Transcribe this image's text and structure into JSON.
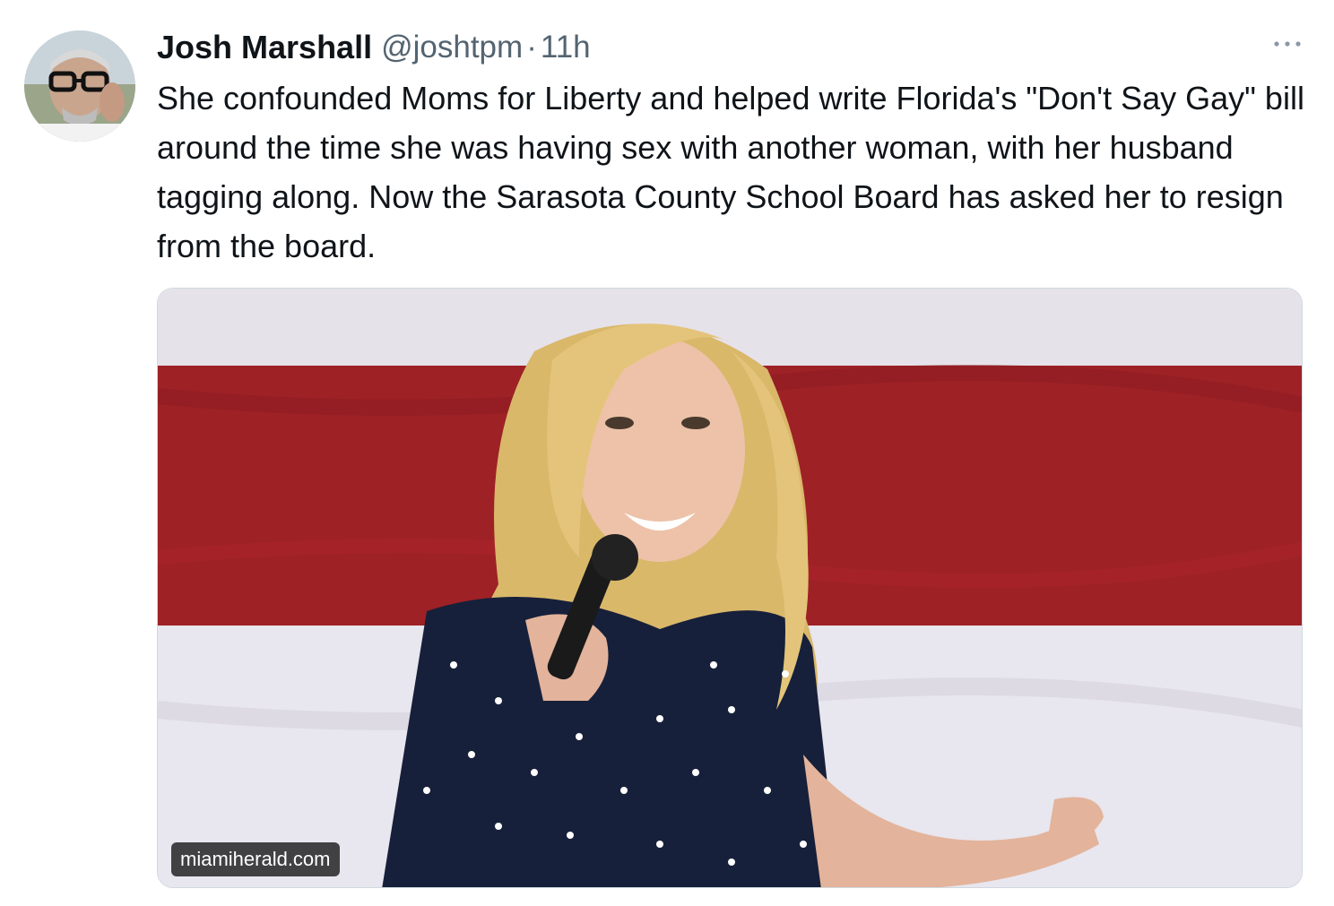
{
  "author": {
    "name": "Josh Marshall",
    "handle": "@joshtpm",
    "separator": "·",
    "time": "11h"
  },
  "tweet": {
    "text": "She confounded Moms for Liberty and helped write Florida's \"Don't Say Gay\" bill around the time she was having sex with another woman, with her husband tagging along. Now the Sarasota County School Board has asked her to resign from the board."
  },
  "media": {
    "source_label": "miamiherald.com"
  },
  "icons": {
    "more": "more-icon",
    "avatar": "avatar"
  },
  "colors": {
    "text": "#0f1419",
    "secondary": "#536471",
    "flag_red": "#9e2126",
    "flag_white": "#ebe7ee"
  }
}
